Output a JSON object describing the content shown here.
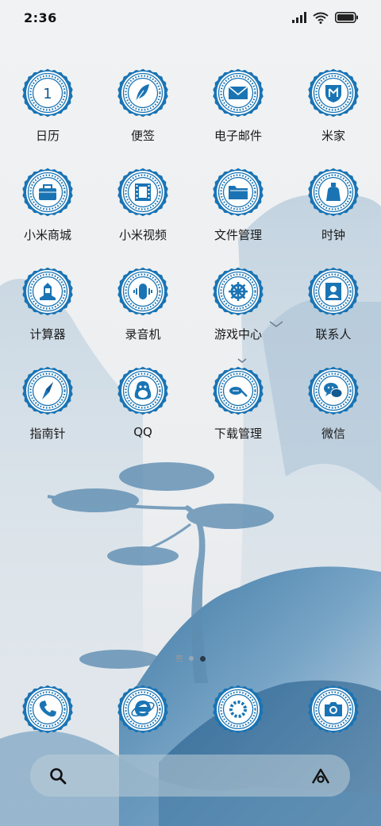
{
  "status_bar": {
    "time": "2:36"
  },
  "apps": [
    {
      "label": "日历",
      "icon": "calendar-icon",
      "calendar_day": "1"
    },
    {
      "label": "便签",
      "icon": "feather-icon"
    },
    {
      "label": "电子邮件",
      "icon": "mail-icon"
    },
    {
      "label": "米家",
      "icon": "mijia-shield-icon"
    },
    {
      "label": "小米商城",
      "icon": "shopping-bag-icon"
    },
    {
      "label": "小米视频",
      "icon": "film-icon"
    },
    {
      "label": "文件管理",
      "icon": "folder-icon"
    },
    {
      "label": "时钟",
      "icon": "bell-icon"
    },
    {
      "label": "计算器",
      "icon": "calculator-icon"
    },
    {
      "label": "录音机",
      "icon": "recorder-icon"
    },
    {
      "label": "游戏中心",
      "icon": "ship-wheel-icon"
    },
    {
      "label": "联系人",
      "icon": "contact-card-icon"
    },
    {
      "label": "指南针",
      "icon": "compass-icon"
    },
    {
      "label": "QQ",
      "icon": "penguin-icon"
    },
    {
      "label": "下载管理",
      "icon": "download-icon"
    },
    {
      "label": "微信",
      "icon": "chat-bubbles-icon"
    }
  ],
  "dock": [
    {
      "icon": "phone-icon"
    },
    {
      "icon": "browser-icon"
    },
    {
      "icon": "dotted-ring-icon"
    },
    {
      "icon": "camera-icon"
    }
  ],
  "pages": {
    "count": 2,
    "current": 2
  },
  "theme": {
    "badge_blue": "#1a74b4",
    "badge_dark": "#13598f",
    "ink": "#1a1a1a"
  }
}
